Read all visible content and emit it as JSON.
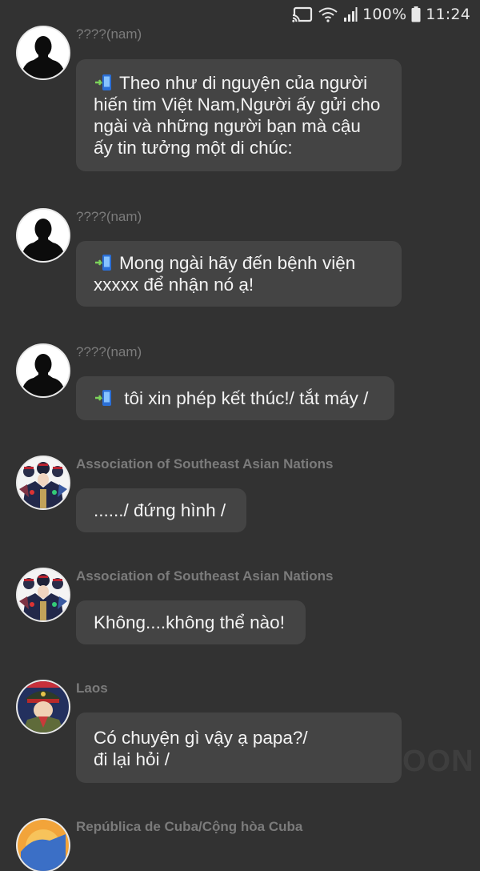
{
  "status_bar": {
    "battery": "100%",
    "time": "11:24",
    "icons": [
      "cast-icon",
      "wifi-icon",
      "signal-icon",
      "battery-icon"
    ]
  },
  "messages": [
    {
      "sender": "????(nam)",
      "avatar": "silhouette-avatar",
      "phone_icon": true,
      "lines": [
        "Theo như di nguyện của người",
        "hiến tim Việt Nam,Người ấy gửi cho",
        "ngài và những người bạn mà cậu",
        "ấy tin tưởng một di chúc:"
      ]
    },
    {
      "sender": "????(nam)",
      "avatar": "silhouette-avatar",
      "phone_icon": true,
      "lines": [
        "Mong ngài hãy đến bệnh viện",
        "xxxxx để nhận nó ạ!"
      ]
    },
    {
      "sender": "????(nam)",
      "avatar": "silhouette-avatar",
      "phone_icon": true,
      "lines": [
        " tôi xin phép kết thúc!/ tắt máy /"
      ]
    },
    {
      "sender": "Association of Southeast Asian Nations",
      "avatar": "asean-avatar",
      "phone_icon": false,
      "lines": [
        "....../ đứng hình /"
      ]
    },
    {
      "sender": "Association of Southeast Asian Nations",
      "avatar": "asean-avatar",
      "phone_icon": false,
      "lines": [
        "Không....không thể nào!"
      ]
    },
    {
      "sender": "Laos",
      "avatar": "laos-avatar",
      "phone_icon": false,
      "lines": [
        "Có chuyện gì vậy ạ papa?/",
        "đi lại hỏi /"
      ]
    },
    {
      "sender": "República de Cuba/Cộng hòa Cuba",
      "avatar": "cuba-avatar",
      "phone_icon": false,
      "lines": []
    }
  ],
  "watermark": "OON",
  "colors": {
    "background": "#323232",
    "bubble": "#444444",
    "sender_text": "#7b7b7b",
    "message_text": "#f3f3f3"
  }
}
